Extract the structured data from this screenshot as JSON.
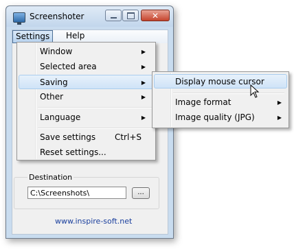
{
  "window": {
    "title": "Screenshoter",
    "close_glyph": "✕"
  },
  "menubar": {
    "items": [
      {
        "label": "Settings"
      },
      {
        "label": "Help"
      }
    ]
  },
  "settings_menu": {
    "items": [
      {
        "label": "Window",
        "submenu": true
      },
      {
        "label": "Selected area",
        "submenu": true
      },
      {
        "label": "Saving",
        "submenu": true
      },
      {
        "label": "Other",
        "submenu": true
      },
      {
        "label": "Language",
        "submenu": true
      },
      {
        "label": "Save settings",
        "shortcut": "Ctrl+S"
      },
      {
        "label": "Reset settings..."
      }
    ]
  },
  "saving_submenu": {
    "items": [
      {
        "label": "Display mouse cursor"
      },
      {
        "label": "Image format",
        "submenu": true
      },
      {
        "label": "Image quality (JPG)",
        "submenu": true
      }
    ]
  },
  "destination": {
    "label": "Destination",
    "path": "C:\\Screenshots\\",
    "browse_label": "..."
  },
  "footer": {
    "link": "www.inspire-soft.net"
  },
  "icons": {
    "submenu_arrow": "▶",
    "app": "monitor-camera-icon"
  },
  "colors": {
    "highlight": "#cfe3f7",
    "link": "#1a3f9d",
    "close_button": "#c5442d"
  }
}
